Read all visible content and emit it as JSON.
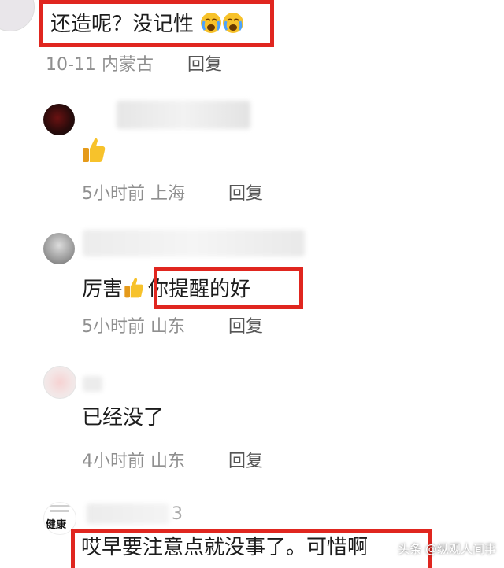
{
  "comments": [
    {
      "text": "还造呢？没记性",
      "time": "10-11",
      "location": "内蒙古",
      "reply_label": "回复"
    },
    {
      "text": "",
      "time": "5小时前",
      "location": "上海",
      "reply_label": "回复"
    },
    {
      "text_before": "厉害",
      "text_boxed": "你提醒的好",
      "time": "5小时前",
      "location": "山东",
      "reply_label": "回复"
    },
    {
      "text": "已经没了",
      "time": "4小时前",
      "location": "山东",
      "reply_label": "回复"
    },
    {
      "text": "哎早要注意点就没事了。可惜啊"
    }
  ],
  "avatar5_caption": "健康",
  "username_fragment": "3",
  "watermark": "头条 @纵观人间事",
  "colors": {
    "highlight_border": "#e0261f",
    "meta": "#8f8f8f"
  }
}
